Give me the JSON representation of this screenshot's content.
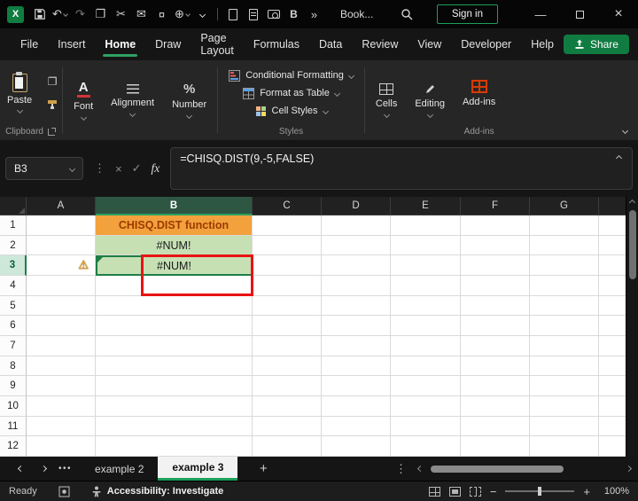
{
  "titlebar": {
    "app_title": "Book...",
    "sign_in_label": "Sign in",
    "overflow_icon": "»",
    "icons": [
      "excel-logo",
      "save",
      "undo",
      "redo",
      "copy",
      "cut",
      "mail",
      "currency",
      "globe",
      "more-commands",
      "separator",
      "new-file",
      "print",
      "camera",
      "bold",
      "overflow",
      "search",
      "minimize",
      "maximize",
      "close"
    ]
  },
  "menubar": {
    "items": [
      "File",
      "Insert",
      "Home",
      "Draw",
      "Page Layout",
      "Formulas",
      "Data",
      "Review",
      "View",
      "Developer",
      "Help"
    ],
    "active_item": "Home",
    "share_label": "Share"
  },
  "ribbon": {
    "paste_label": "Paste",
    "font_label": "Font",
    "alignment_label": "Alignment",
    "number_label": "Number",
    "styles_items": [
      "Conditional Formatting",
      "Format as Table",
      "Cell Styles"
    ],
    "cells_label": "Cells",
    "editing_label": "Editing",
    "addins_label": "Add-ins",
    "group_labels": {
      "clipboard": "Clipboard",
      "styles": "Styles",
      "addins": "Add-ins"
    }
  },
  "formula_bar": {
    "name_box": "B3",
    "fx_label": "fx",
    "formula": "=CHISQ.DIST(9,-5,FALSE)"
  },
  "grid": {
    "columns": [
      "A",
      "B",
      "C",
      "D",
      "E",
      "F",
      "G"
    ],
    "rows": [
      "1",
      "2",
      "3",
      "4",
      "5",
      "6",
      "7",
      "8",
      "9",
      "10",
      "11",
      "12"
    ],
    "selected_column": "B",
    "selected_row": "3",
    "active_cell": "B3",
    "warning_cell": "A3",
    "cells": [
      {
        "ref": "B1",
        "text": "CHISQ.DIST function",
        "style": "title"
      },
      {
        "ref": "B2",
        "text": "#NUM!",
        "style": "numerr"
      },
      {
        "ref": "B3",
        "text": "#NUM!",
        "style": "numerr"
      }
    ]
  },
  "sheet_tabs": {
    "tabs": [
      "example 2",
      "example 3"
    ],
    "active_tab": "example 3",
    "ellipsis": "•••",
    "add_label": "+",
    "options_icon": "⋮"
  },
  "status_bar": {
    "ready_label": "Ready",
    "accessibility_label": "Accessibility: Investigate",
    "zoom_level": "100%"
  },
  "colors": {
    "accent_green": "#2EA163",
    "excel_green": "#107C41",
    "orange_fill": "#F2A13C",
    "orange_text": "#9C3A00",
    "error_fill": "#C6E0B4",
    "annotation_red": "#E81313",
    "warning_amber": "#E2A33D"
  }
}
